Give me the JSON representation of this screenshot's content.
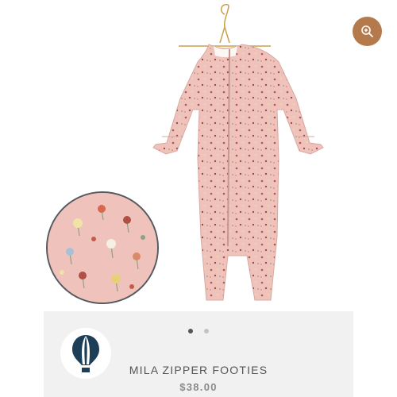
{
  "colors": {
    "zoom_button": "#b57a4c",
    "garment_pink": "#efc3bc",
    "panel_background": "#f1f1f1",
    "logo_navy": "#1c3f57",
    "title_text": "#555555",
    "price_text": "#8a8a8a"
  },
  "image": {
    "icon": "zoom-in-icon"
  },
  "carousel": {
    "total_slides": 2,
    "active_slide": 1
  },
  "brand": {
    "logo_icon": "hot-air-balloon-icon"
  },
  "product": {
    "title": "MILA ZIPPER FOOTIES",
    "price": "$38.00"
  }
}
